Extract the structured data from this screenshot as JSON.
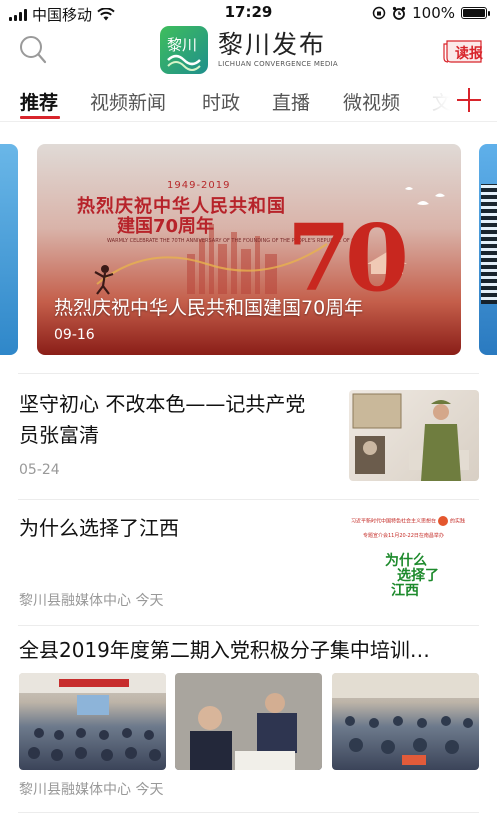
{
  "status_bar": {
    "carrier": "中国移动",
    "time": "17:29",
    "battery": "100%"
  },
  "header": {
    "logo_title": "黎川发布",
    "logo_subtitle": "LICHUAN CONVERGENCE MEDIA",
    "logo_mark_text": "黎川",
    "read_paper_label": "读报"
  },
  "tabs": [
    {
      "label": "推荐",
      "active": true
    },
    {
      "label": "视频新闻",
      "active": false
    },
    {
      "label": "时政",
      "active": false
    },
    {
      "label": "直播",
      "active": false
    },
    {
      "label": "微视频",
      "active": false
    },
    {
      "label": "文",
      "active": false
    }
  ],
  "banner": {
    "year_range": "1949-2019",
    "headline_1": "热烈庆祝中华人民共和国",
    "headline_2": "建国70周年",
    "english": "WARMLY CELEBRATE THE 70TH ANNIVERSARY OF THE FOUNDING OF THE PEOPLE'S REPUBLIC OF CHINA",
    "big_number": "70",
    "title": "热烈庆祝中华人民共和国建国70周年",
    "date": "09-16"
  },
  "articles": [
    {
      "title_line1": "坚守初心  不改本色——记共产党",
      "title_line2": "员张富清",
      "meta": "05-24"
    },
    {
      "title": "为什么选择了江西",
      "meta": "黎川县融媒体中心  今天",
      "thumb_top_text": "习近平新时代中国特色社会主义思想在",
      "thumb_top_text2": "的实践",
      "thumb_sub_text": "专题宣介会11月20-22日在南昌举办",
      "thumb_big_1": "为什么",
      "thumb_big_2": "选择了",
      "thumb_big_3": "江西"
    },
    {
      "title": "全县2019年度第二期入党积极分子集中培训…",
      "meta": "黎川县融媒体中心  今天"
    }
  ],
  "colors": {
    "accent": "#d8242b",
    "meta_gray": "#999999"
  }
}
